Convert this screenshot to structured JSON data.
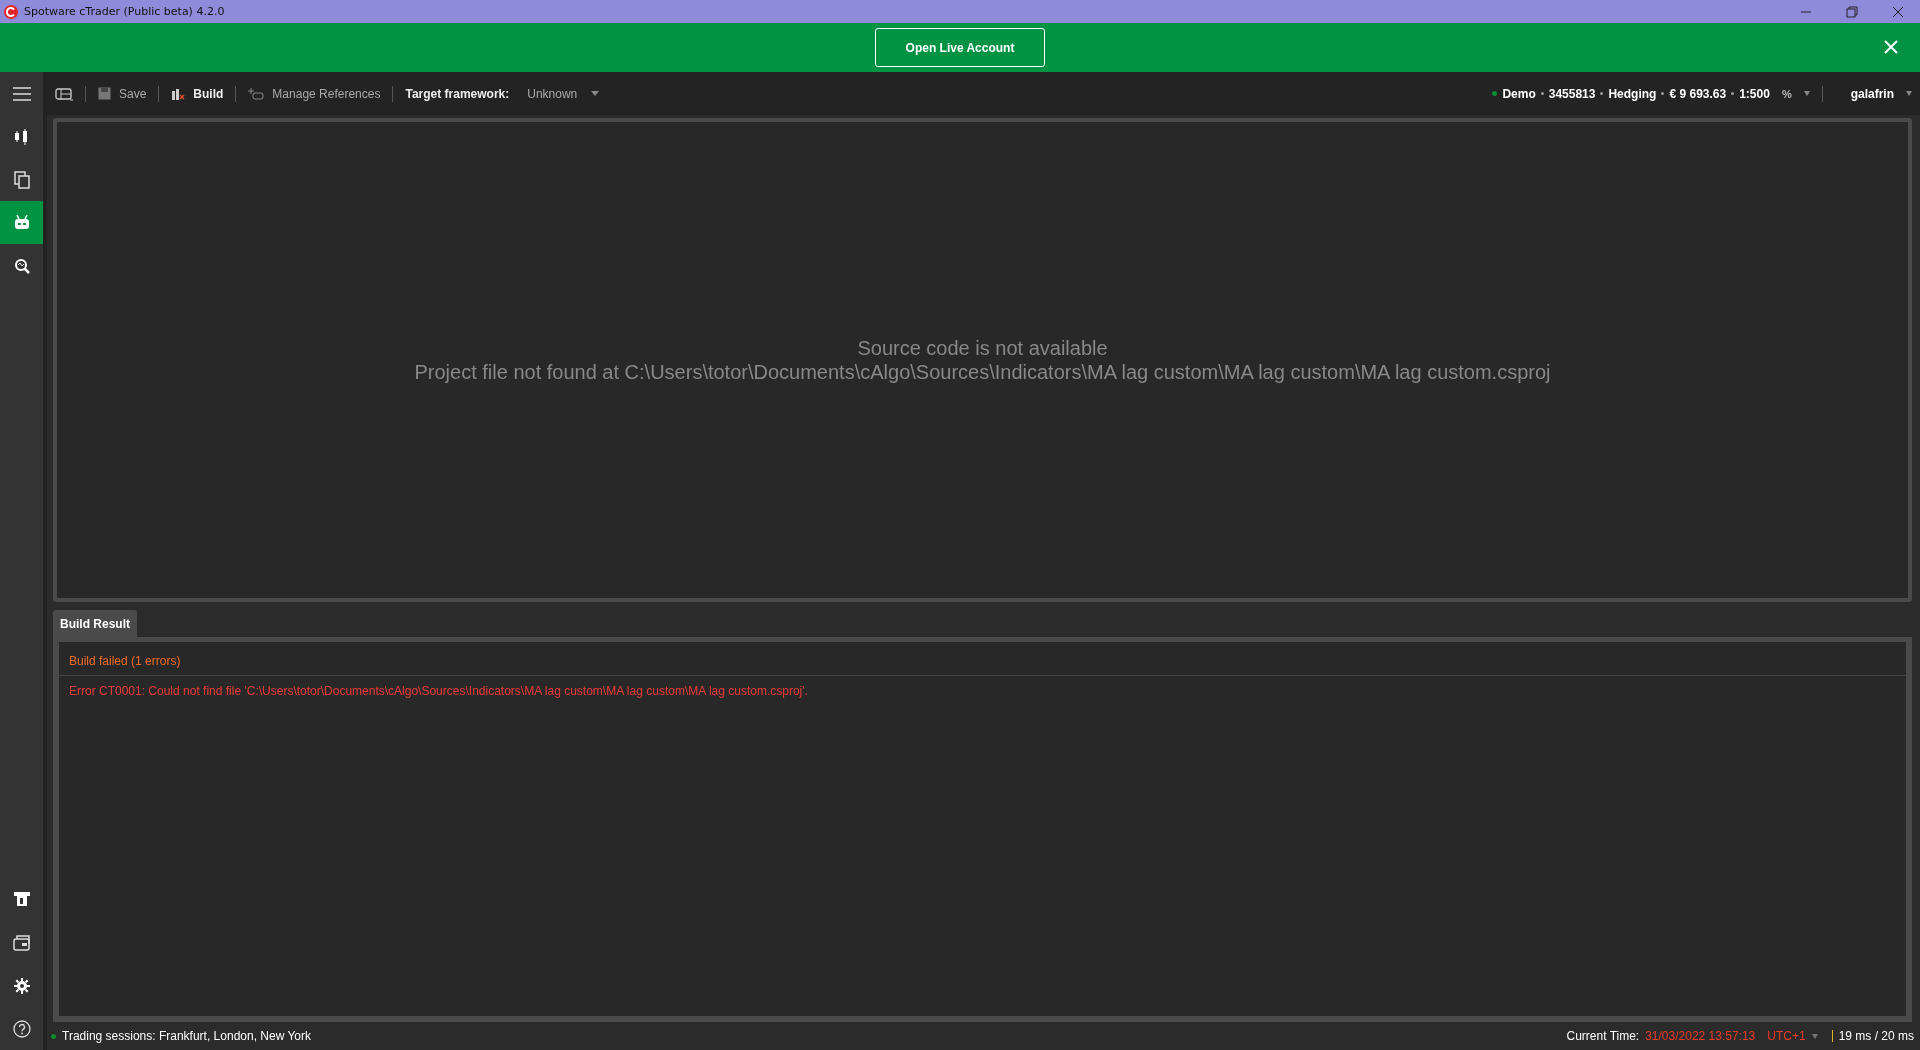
{
  "window": {
    "title": "Spotware cTrader (Public beta) 4.2.0"
  },
  "banner": {
    "button": "Open Live Account"
  },
  "toolbar": {
    "save": "Save",
    "build": "Build",
    "manage_references": "Manage References",
    "target_label": "Target framework:",
    "target_value": "Unknown"
  },
  "account": {
    "parts": [
      "Demo",
      "3455813",
      "Hedging",
      "€ 9 693.63",
      "1:500"
    ],
    "percent": "%",
    "user": "galafrin"
  },
  "sidebar": {
    "items": [
      {
        "selected": false
      },
      {
        "selected": false
      },
      {
        "selected": true
      },
      {
        "selected": false
      }
    ]
  },
  "editor": {
    "title": "Source code is not available",
    "message": "Project file not found at C:\\Users\\totor\\Documents\\cAlgo\\Sources\\Indicators\\MA lag custom\\MA lag custom\\MA lag custom.csproj"
  },
  "build_panel": {
    "tab": "Build Result",
    "status": "Build failed (1 errors)",
    "error": "Error CT0001: Could not find file 'C:\\Users\\totor\\Documents\\cAlgo\\Sources\\Indicators\\MA lag custom\\MA lag custom\\MA lag custom.csproj'."
  },
  "status_bar": {
    "sessions": "Trading sessions: Frankfurt, London, New York",
    "time_label": "Current Time:",
    "time": "31/03/2022 13:57:13",
    "timezone": "UTC+1",
    "latency": "19 ms / 20 ms"
  }
}
